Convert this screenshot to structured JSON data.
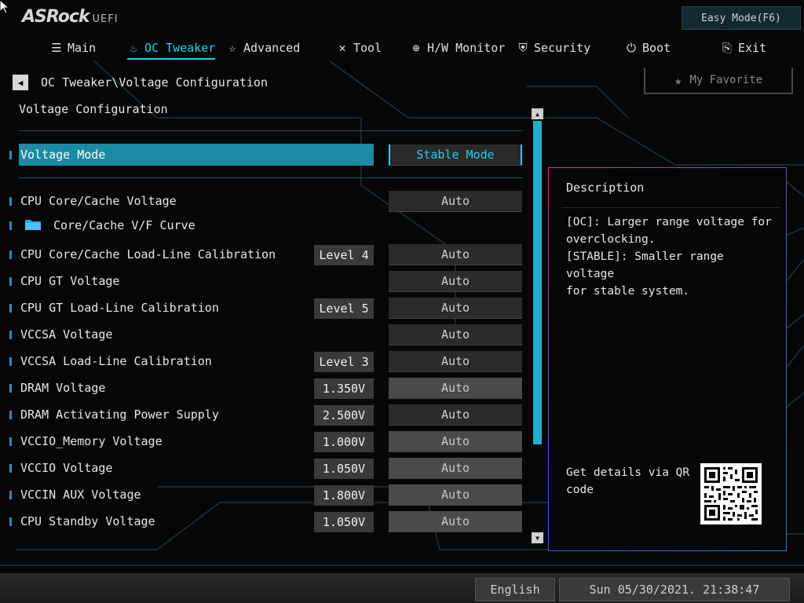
{
  "brand": {
    "name": "ASRock",
    "suffix": "UEFI"
  },
  "easy_mode_label": "Easy Mode(F6)",
  "nav": {
    "tabs": [
      {
        "label": "Main",
        "icon": "list-icon"
      },
      {
        "label": "OC Tweaker",
        "icon": "flame-icon",
        "active": true
      },
      {
        "label": "Advanced",
        "icon": "star-outline-icon"
      },
      {
        "label": "Tool",
        "icon": "tools-icon"
      },
      {
        "label": "H/W Monitor",
        "icon": "crosshair-icon"
      },
      {
        "label": "Security",
        "icon": "shield-icon"
      },
      {
        "label": "Boot",
        "icon": "power-icon"
      },
      {
        "label": "Exit",
        "icon": "exit-door-icon"
      }
    ]
  },
  "breadcrumb": "OC Tweaker\\Voltage Configuration",
  "favorite_label": "My Favorite",
  "section_title": "Voltage Configuration",
  "settings": [
    {
      "label": "Voltage Mode",
      "current": "",
      "value": "Stable Mode",
      "selected": true
    },
    {
      "label": "CPU Core/Cache Voltage",
      "current": "",
      "value": "Auto"
    },
    {
      "label": "Core/Cache V/F Curve",
      "current": "",
      "value": "",
      "folder": true
    },
    {
      "label": "CPU Core/Cache Load-Line Calibration",
      "current": "Level 4",
      "value": "Auto"
    },
    {
      "label": "CPU GT Voltage",
      "current": "",
      "value": "Auto"
    },
    {
      "label": "CPU GT Load-Line Calibration",
      "current": "Level 5",
      "value": "Auto"
    },
    {
      "label": "VCCSA Voltage",
      "current": "",
      "value": "Auto"
    },
    {
      "label": "VCCSA Load-Line Calibration",
      "current": "Level 3",
      "value": "Auto"
    },
    {
      "label": "DRAM Voltage",
      "current": "1.350V",
      "value": "Auto"
    },
    {
      "label": "DRAM Activating Power Supply",
      "current": "2.500V",
      "value": "Auto"
    },
    {
      "label": "VCCIO_Memory Voltage",
      "current": "1.000V",
      "value": "Auto"
    },
    {
      "label": "VCCIO Voltage",
      "current": "1.050V",
      "value": "Auto"
    },
    {
      "label": "VCCIN AUX Voltage",
      "current": "1.800V",
      "value": "Auto"
    },
    {
      "label": "CPU Standby Voltage",
      "current": "1.050V",
      "value": "Auto"
    }
  ],
  "description": {
    "title": "Description",
    "text": "[OC]: Larger range voltage for\noverclocking.\n[STABLE]: Smaller range voltage\nfor stable system.",
    "qr_text": "Get details via QR code"
  },
  "footer": {
    "language": "English",
    "datetime": "Sun 05/30/2021. 21:38:47"
  },
  "colors": {
    "accent": "#22d0f0",
    "selected_row": "#1b8aa2",
    "background": "#050607"
  },
  "scroll_position_fraction": 0
}
